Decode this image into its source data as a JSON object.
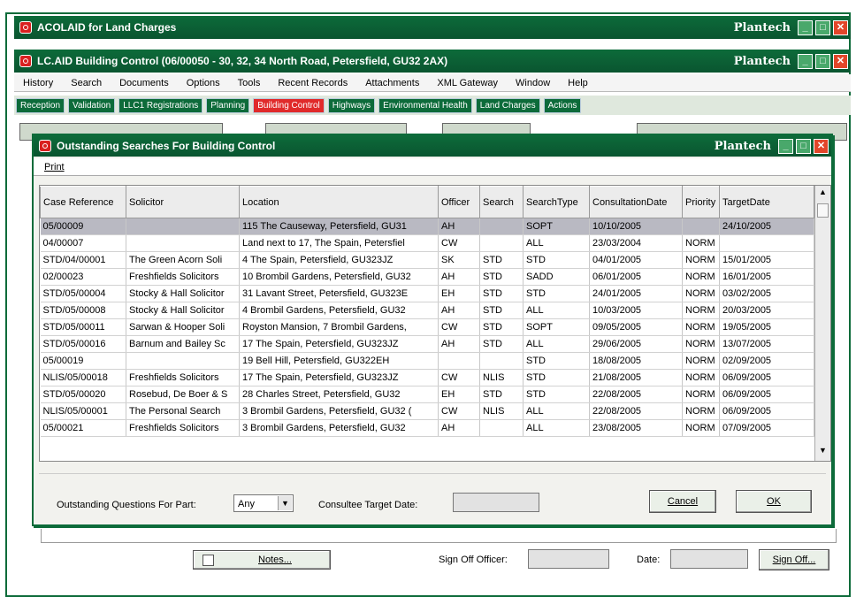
{
  "outer_window": {
    "title": "ACOLAID for Land Charges",
    "brand": "Plantech"
  },
  "inner_window": {
    "title": "LC.AID Building Control (06/00050 - 30, 32, 34 North Road, Petersfield, GU32 2AX)",
    "brand": "Plantech"
  },
  "menu": [
    "History",
    "Search",
    "Documents",
    "Options",
    "Tools",
    "Recent Records",
    "Attachments",
    "XML Gateway",
    "Window",
    "Help"
  ],
  "modules": [
    {
      "label": "Reception",
      "active": false
    },
    {
      "label": "Validation",
      "active": false
    },
    {
      "label": "LLC1 Registrations",
      "active": false
    },
    {
      "label": "Planning",
      "active": false
    },
    {
      "label": "Building Control",
      "active": true
    },
    {
      "label": "Highways",
      "active": false
    },
    {
      "label": "Environmental Health",
      "active": false
    },
    {
      "label": "Land Charges",
      "active": false
    },
    {
      "label": "Actions",
      "active": false
    }
  ],
  "dialog": {
    "title": "Outstanding Searches For Building Control",
    "brand": "Plantech",
    "menu_print": "Print",
    "columns": [
      "Case Reference",
      "Solicitor",
      "Location",
      "Officer",
      "Search",
      "SearchType",
      "ConsultationDate",
      "Priority",
      "TargetDate"
    ],
    "rows": [
      [
        "05/00009",
        "",
        "115 The Causeway, Petersfield, GU31",
        "AH",
        "",
        "SOPT",
        "10/10/2005",
        "",
        "24/10/2005"
      ],
      [
        "04/00007",
        "",
        "Land next to 17, The Spain, Petersfiel",
        "CW",
        "",
        "ALL",
        "23/03/2004",
        "NORM",
        ""
      ],
      [
        "STD/04/00001",
        "The Green Acorn Soli",
        "4 The Spain, Petersfield, GU323JZ",
        "SK",
        "STD",
        "STD",
        "04/01/2005",
        "NORM",
        "15/01/2005"
      ],
      [
        "02/00023",
        "Freshfields Solicitors",
        "10 Brombil Gardens, Petersfield, GU32",
        "AH",
        "STD",
        "SADD",
        "06/01/2005",
        "NORM",
        "16/01/2005"
      ],
      [
        "STD/05/00004",
        "Stocky & Hall Solicitor",
        "31 Lavant Street, Petersfield, GU323E",
        "EH",
        "STD",
        "STD",
        "24/01/2005",
        "NORM",
        "03/02/2005"
      ],
      [
        "STD/05/00008",
        "Stocky & Hall Solicitor",
        "4 Brombil Gardens, Petersfield, GU32",
        "AH",
        "STD",
        "ALL",
        "10/03/2005",
        "NORM",
        "20/03/2005"
      ],
      [
        "STD/05/00011",
        "Sarwan & Hooper Soli",
        "Royston Mansion, 7 Brombil Gardens,",
        "CW",
        "STD",
        "SOPT",
        "09/05/2005",
        "NORM",
        "19/05/2005"
      ],
      [
        "STD/05/00016",
        "Barnum and Bailey Sc",
        "17 The Spain, Petersfield, GU323JZ",
        "AH",
        "STD",
        "ALL",
        "29/06/2005",
        "NORM",
        "13/07/2005"
      ],
      [
        "05/00019",
        "",
        "19 Bell Hill, Petersfield, GU322EH",
        "",
        "",
        "STD",
        "18/08/2005",
        "NORM",
        "02/09/2005"
      ],
      [
        "NLIS/05/00018",
        "Freshfields Solicitors",
        "17 The Spain, Petersfield, GU323JZ",
        "CW",
        "NLIS",
        "STD",
        "21/08/2005",
        "NORM",
        "06/09/2005"
      ],
      [
        "STD/05/00020",
        "Rosebud, De Boer & S",
        "28 Charles Street, Petersfield, GU32",
        "EH",
        "STD",
        "STD",
        "22/08/2005",
        "NORM",
        "06/09/2005"
      ],
      [
        "NLIS/05/00001",
        "The Personal Search",
        "3 Brombil Gardens, Petersfield, GU32 (",
        "CW",
        "NLIS",
        "ALL",
        "22/08/2005",
        "NORM",
        "06/09/2005"
      ],
      [
        "05/00021",
        "Freshfields Solicitors",
        "3 Brombil Gardens, Petersfield, GU32",
        "AH",
        "",
        "ALL",
        "23/08/2005",
        "NORM",
        "07/09/2005"
      ]
    ],
    "filter_label": "Outstanding Questions For Part:",
    "filter_value": "Any",
    "target_label": "Consultee Target Date:",
    "target_value": "",
    "cancel_label": "Cancel",
    "ok_label": "OK"
  },
  "bottom": {
    "notes_label": "Notes...",
    "signoff_officer_label": "Sign Off Officer:",
    "signoff_officer_value": "",
    "date_label": "Date:",
    "date_value": "",
    "signoff_button": "Sign Off..."
  }
}
